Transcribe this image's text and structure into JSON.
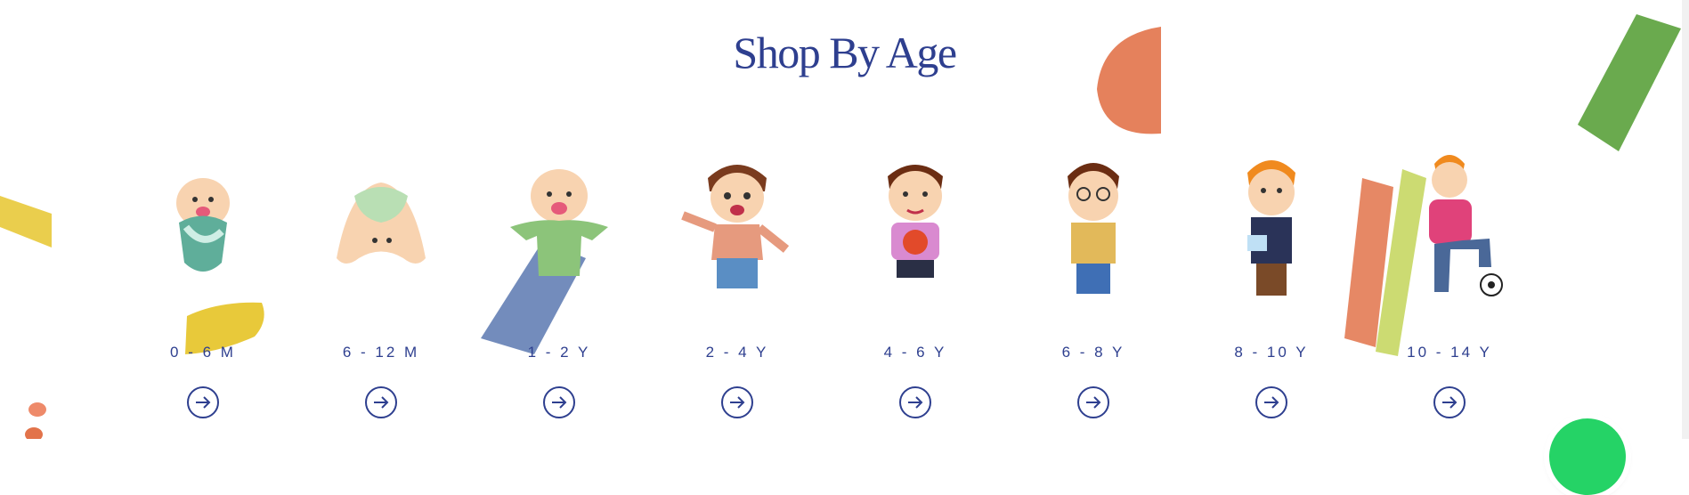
{
  "section": {
    "title": "Shop By Age"
  },
  "age_groups": [
    {
      "label": "0 - 6 M",
      "icon": "baby-swaddled-icon"
    },
    {
      "label": "6 - 12 M",
      "icon": "baby-crawling-icon"
    },
    {
      "label": "1 - 2 Y",
      "icon": "toddler-icon"
    },
    {
      "label": "2 - 4 Y",
      "icon": "child-waving-icon"
    },
    {
      "label": "4 - 6 Y",
      "icon": "child-basketball-icon"
    },
    {
      "label": "6 - 8 Y",
      "icon": "child-backpack-icon"
    },
    {
      "label": "8 - 10 Y",
      "icon": "boy-notebook-icon"
    },
    {
      "label": "10 - 14 Y",
      "icon": "teen-football-icon"
    }
  ],
  "arrow_icon": "arrow-right-circle-icon",
  "whatsapp_icon": "whatsapp-icon",
  "colors": {
    "accent": "#2e3f8f",
    "yellow": "#e8c93a",
    "orange": "#e2734a",
    "blue": "#5a78b0",
    "green": "#6aaa4e",
    "lime": "#c9d96a"
  }
}
